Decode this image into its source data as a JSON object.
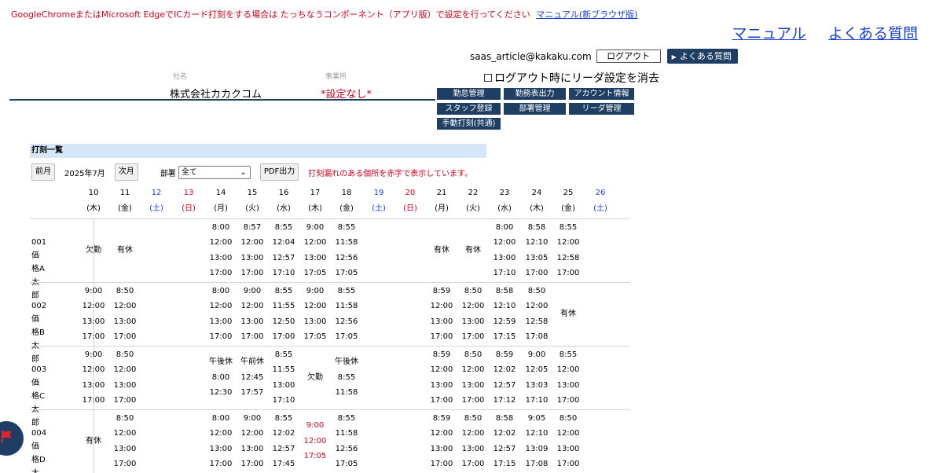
{
  "notice": {
    "text": "GoogleChromeまたはMicrosoft EdgeでICカード打刻をする場合は たっちなうコンポーネント（アプリ版）で設定を行ってください",
    "link": "マニュアル(新ブラウザ版)"
  },
  "toplinks": {
    "manual": "マニュアル",
    "faq": "よくある質問"
  },
  "user": {
    "email": "saas_article@kakaku.com",
    "logout": "ログアウト",
    "faq": "よくある質問"
  },
  "clear_setting": "ログアウト時にリーダ設定を消去",
  "company": {
    "label": "社名",
    "value": "株式会社カカクコム"
  },
  "office": {
    "label": "事業所",
    "value": "*設定なし*"
  },
  "nav": [
    {
      "label": "勤怠管理"
    },
    {
      "label": "勤務表出力"
    },
    {
      "label": "アカウント情報"
    },
    {
      "label": "スタッフ登録"
    },
    {
      "label": "部署管理"
    },
    {
      "label": "リーダ管理"
    },
    {
      "label": "手動打刻(共通)"
    }
  ],
  "section_title": "打刻一覧",
  "controls": {
    "prev": "前月",
    "month": "2025年7月",
    "next": "次月",
    "dept_label": "部署",
    "dept_value": "全て",
    "pdf": "PDF出力",
    "warning": "打刻漏れのある個所を赤字で表示しています。"
  },
  "colors": {
    "navy": "#1f3e64",
    "red": "#d0021b",
    "blue": "#1a3fd6",
    "section_bg": "#d7e7fb"
  },
  "days": [
    {
      "d": "10",
      "w": "(木)",
      "t": ""
    },
    {
      "d": "11",
      "w": "(金)",
      "t": ""
    },
    {
      "d": "12",
      "w": "(土)",
      "t": "sat"
    },
    {
      "d": "13",
      "w": "(日)",
      "t": "sun"
    },
    {
      "d": "14",
      "w": "(月)",
      "t": ""
    },
    {
      "d": "15",
      "w": "(火)",
      "t": ""
    },
    {
      "d": "16",
      "w": "(水)",
      "t": ""
    },
    {
      "d": "17",
      "w": "(木)",
      "t": ""
    },
    {
      "d": "18",
      "w": "(金)",
      "t": ""
    },
    {
      "d": "19",
      "w": "(土)",
      "t": "sat"
    },
    {
      "d": "20",
      "w": "(日)",
      "t": "sun"
    },
    {
      "d": "21",
      "w": "(月)",
      "t": ""
    },
    {
      "d": "22",
      "w": "(火)",
      "t": ""
    },
    {
      "d": "23",
      "w": "(水)",
      "t": ""
    },
    {
      "d": "24",
      "w": "(木)",
      "t": ""
    },
    {
      "d": "25",
      "w": "(金)",
      "t": ""
    },
    {
      "d": "26",
      "w": "(土)",
      "t": "sat"
    }
  ],
  "employees": [
    {
      "id": "001",
      "name": "価格A太郎",
      "cells": [
        [
          "欠勤"
        ],
        [
          "有休"
        ],
        [],
        [],
        [
          "8:00",
          "12:00",
          "13:00",
          "17:00"
        ],
        [
          "8:57",
          "12:00",
          "13:00",
          "17:00"
        ],
        [
          "8:55",
          "12:04",
          "12:57",
          "17:10"
        ],
        [
          "9:00",
          "12:00",
          "13:00",
          "17:05"
        ],
        [
          "8:55",
          "11:58",
          "12:56",
          "17:05"
        ],
        [],
        [],
        [
          "有休"
        ],
        [
          "有休"
        ],
        [
          "8:00",
          "12:00",
          "13:00",
          "17:10"
        ],
        [
          "8:58",
          "12:10",
          "13:05",
          "17:00"
        ],
        [
          "8:55",
          "12:00",
          "12:58",
          "17:00"
        ],
        []
      ]
    },
    {
      "id": "002",
      "name": "価格B太郎",
      "cells": [
        [
          "9:00",
          "12:00",
          "13:00",
          "17:00"
        ],
        [
          "8:50",
          "12:00",
          "13:00",
          "17:00"
        ],
        [],
        [],
        [
          "8:00",
          "12:00",
          "13:00",
          "17:00"
        ],
        [
          "9:00",
          "12:00",
          "13:00",
          "17:00"
        ],
        [
          "8:55",
          "11:55",
          "12:50",
          "17:00"
        ],
        [
          "9:00",
          "12:00",
          "13:00",
          "17:05"
        ],
        [
          "8:55",
          "11:58",
          "12:56",
          "17:05"
        ],
        [],
        [],
        [
          "8:59",
          "12:00",
          "13:00",
          "17:00"
        ],
        [
          "8:50",
          "12:00",
          "13:00",
          "17:00"
        ],
        [
          "8:58",
          "12:10",
          "12:59",
          "17:15"
        ],
        [
          "8:50",
          "12:00",
          "12:58",
          "17:08"
        ],
        [
          "有休"
        ],
        []
      ]
    },
    {
      "id": "003",
      "name": "価格C太郎",
      "cells": [
        [
          "9:00",
          "12:00",
          "13:00",
          "17:00"
        ],
        [
          "8:50",
          "12:00",
          "13:00",
          "17:00"
        ],
        [],
        [],
        [
          "午後休",
          "8:00",
          "12:30"
        ],
        [
          "午前休",
          "12:45",
          "17:57"
        ],
        [
          "8:55",
          "11:55",
          "13:00",
          "17:10"
        ],
        [
          "欠勤"
        ],
        [
          "午後休",
          "8:55",
          "11:58"
        ],
        [],
        [],
        [
          "8:59",
          "12:00",
          "13:00",
          "17:00"
        ],
        [
          "8:50",
          "12:00",
          "13:00",
          "17:00"
        ],
        [
          "8:59",
          "12:02",
          "12:57",
          "17:12"
        ],
        [
          "9:00",
          "12:05",
          "13:03",
          "17:10"
        ],
        [
          "8:55",
          "12:00",
          "13:00",
          "17:00"
        ],
        []
      ]
    },
    {
      "id": "004",
      "name": "価格D太郎",
      "cells": [
        [
          "有休"
        ],
        [
          "8:50",
          "12:00",
          "13:00",
          "17:00"
        ],
        [],
        [],
        [
          "8:00",
          "12:00",
          "13:00",
          "17:00"
        ],
        [
          "9:00",
          "12:00",
          "13:00",
          "17:00"
        ],
        [
          "8:55",
          "12:02",
          "12:57",
          "17:45"
        ],
        [
          "!9:00",
          "!12:00",
          "!17:05"
        ],
        [
          "8:55",
          "11:58",
          "12:56",
          "17:05"
        ],
        [],
        [],
        [
          "8:59",
          "12:00",
          "13:00",
          "17:00"
        ],
        [
          "8:50",
          "12:00",
          "13:00",
          "17:00"
        ],
        [
          "8:58",
          "12:02",
          "12:57",
          "17:15"
        ],
        [
          "9:05",
          "12:10",
          "13:09",
          "17:08"
        ],
        [
          "8:50",
          "12:00",
          "13:00",
          "17:00"
        ],
        []
      ]
    }
  ]
}
